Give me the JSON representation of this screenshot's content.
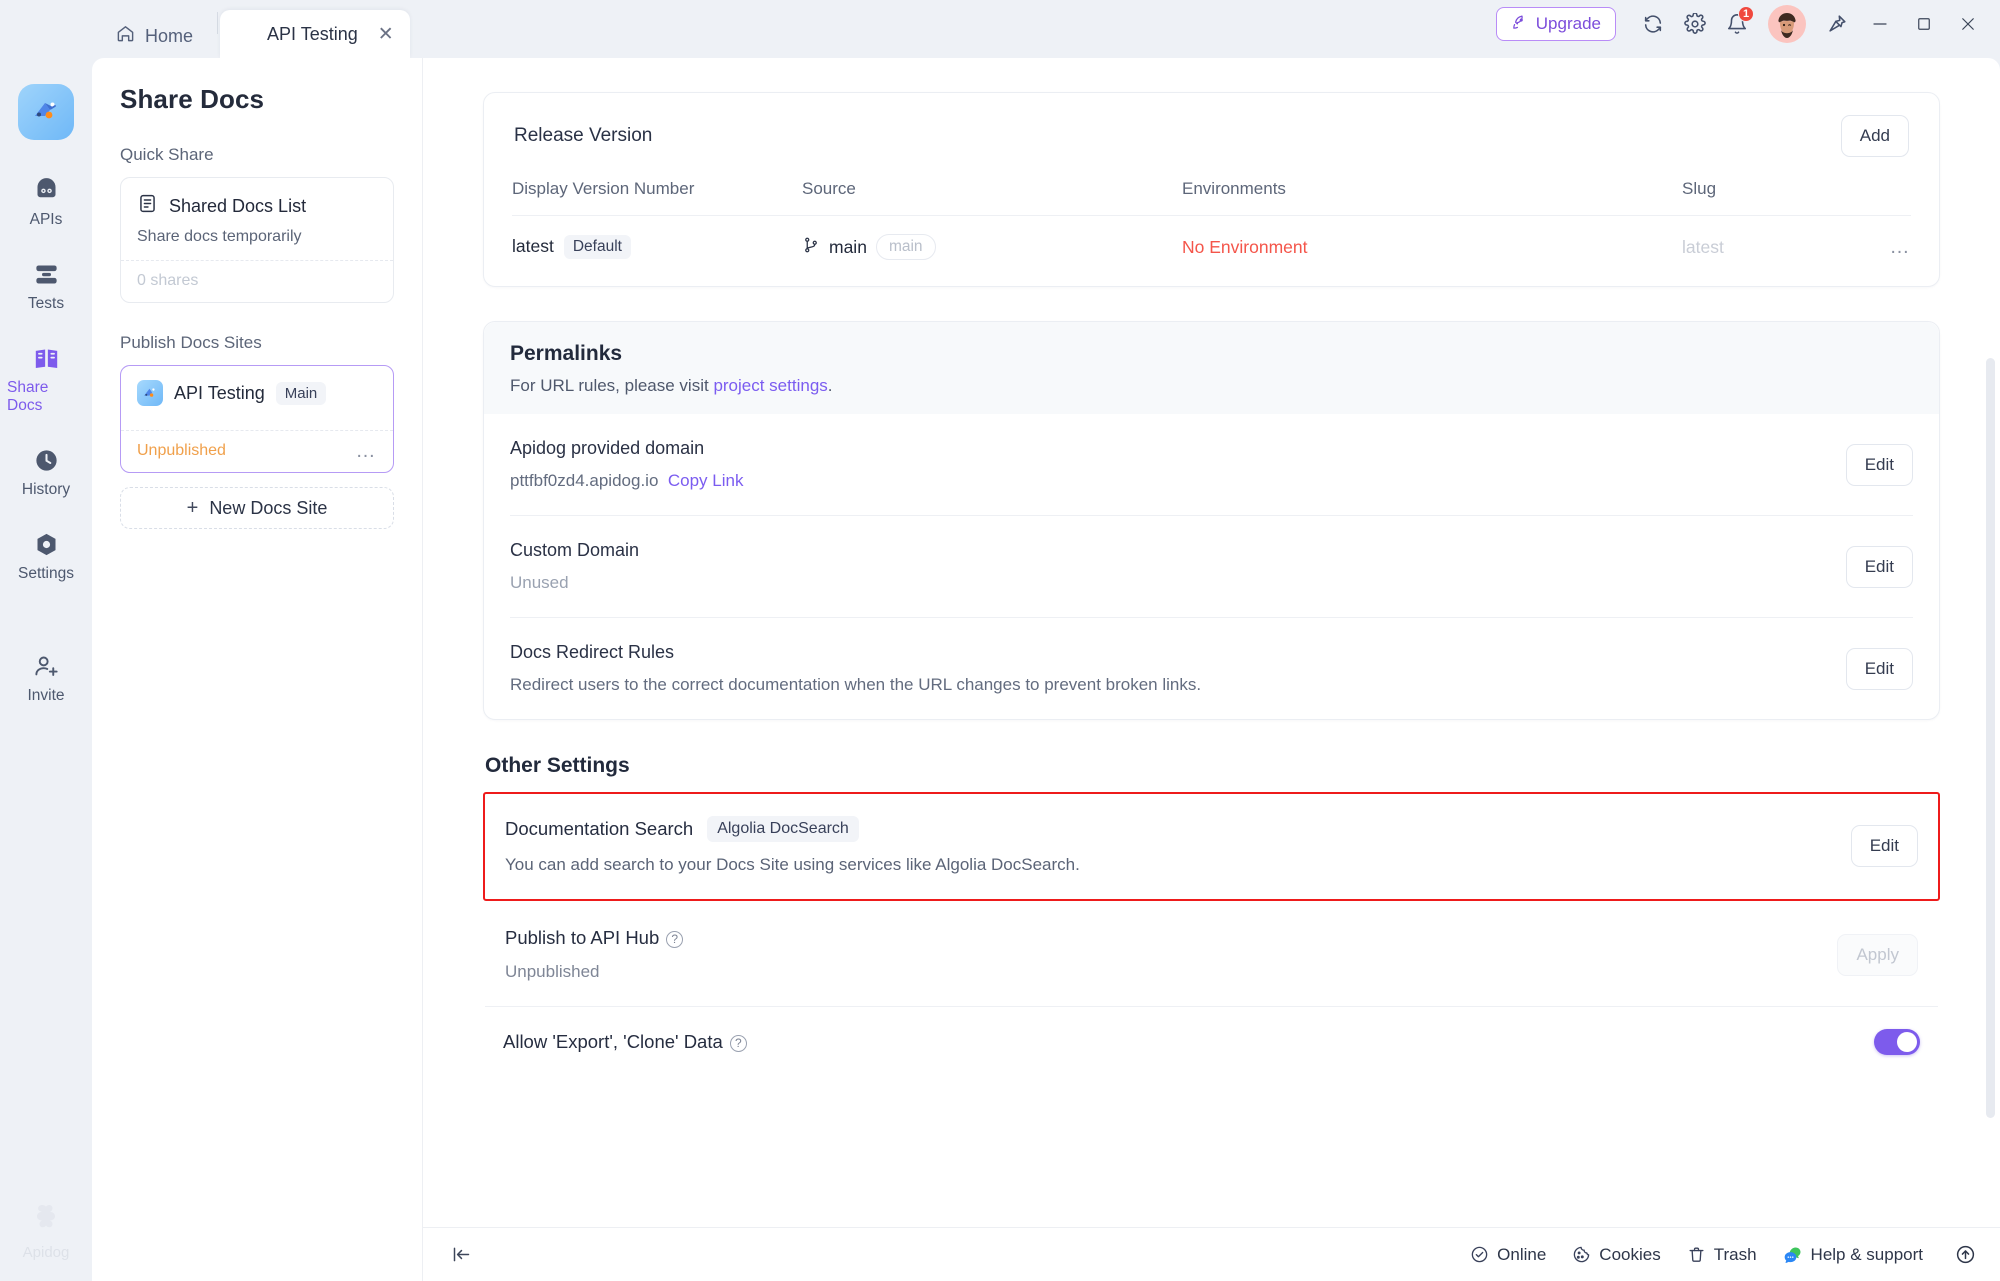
{
  "titlebar": {
    "home_tab": "Home",
    "active_tab": "API Testing",
    "upgrade_label": "Upgrade",
    "notification_count": "1",
    "icons": [
      "rocket-icon",
      "sync-icon",
      "gear-icon",
      "bell-icon",
      "avatar",
      "pin-icon",
      "minimize-icon",
      "maximize-icon",
      "close-icon"
    ]
  },
  "rail": {
    "items": [
      {
        "label": "APIs",
        "icon": "apis-icon",
        "active": false
      },
      {
        "label": "Tests",
        "icon": "tests-icon",
        "active": false
      },
      {
        "label": "Share Docs",
        "icon": "share-docs-icon",
        "active": true
      },
      {
        "label": "History",
        "icon": "history-icon",
        "active": false
      },
      {
        "label": "Settings",
        "icon": "settings-icon",
        "active": false
      }
    ],
    "invite": {
      "label": "Invite",
      "icon": "invite-user-icon"
    },
    "brand": "Apidog"
  },
  "left_panel": {
    "title": "Share Docs",
    "quick_share": {
      "section_label": "Quick Share",
      "card_title": "Shared Docs List",
      "card_subtitle": "Share docs temporarily",
      "shares_count": "0 shares"
    },
    "publish_sites": {
      "section_label": "Publish Docs Sites",
      "site_name": "API Testing",
      "site_badge": "Main",
      "site_status": "Unpublished",
      "new_site_label": "New Docs Site",
      "new_site_plus": "+"
    }
  },
  "release_version": {
    "title": "Release Version",
    "add_label": "Add",
    "columns": [
      "Display Version Number",
      "Source",
      "Environments",
      "Slug"
    ],
    "rows": [
      {
        "version": "latest",
        "version_badge": "Default",
        "source_branch": "main",
        "source_chip": "main",
        "environments": "No Environment",
        "slug": "latest"
      }
    ]
  },
  "permalinks": {
    "title": "Permalinks",
    "subtitle_prefix": "For URL rules, please visit ",
    "subtitle_link": "project settings",
    "subtitle_suffix": ".",
    "rows": [
      {
        "label": "Apidog provided domain",
        "value": "pttfbf0zd4.apidog.io",
        "link": "Copy Link",
        "action": "Edit"
      },
      {
        "label": "Custom Domain",
        "value": "Unused",
        "action": "Edit"
      },
      {
        "label": "Docs Redirect Rules",
        "value": "Redirect users to the correct documentation when the URL changes to prevent broken links.",
        "action": "Edit"
      }
    ]
  },
  "other_settings": {
    "title": "Other Settings",
    "doc_search": {
      "label": "Documentation Search",
      "badge": "Algolia DocSearch",
      "description": "You can add search to your Docs Site using services like Algolia DocSearch.",
      "action": "Edit",
      "highlight_color": "#ee1b1b"
    },
    "api_hub": {
      "label": "Publish to API Hub",
      "value": "Unpublished",
      "action": "Apply"
    },
    "export_clone": {
      "label": "Allow 'Export', 'Clone' Data",
      "toggle_on": true
    }
  },
  "statusbar": {
    "items": [
      {
        "label": "Online",
        "icon": "check-circle-icon"
      },
      {
        "label": "Cookies",
        "icon": "cookie-icon"
      },
      {
        "label": "Trash",
        "icon": "trash-icon"
      },
      {
        "label": "Help & support",
        "icon": "help-chat-icon"
      }
    ],
    "collapse_icon": "collapse-panel-icon",
    "scroll_top_icon": "arrow-up-circle-icon"
  },
  "colors": {
    "accent_purple": "#7d5bec",
    "warning_orange": "#f0a04b",
    "danger_red": "#f4554a",
    "highlight_red": "#ee1b1b",
    "badge_red": "#f0483e"
  }
}
